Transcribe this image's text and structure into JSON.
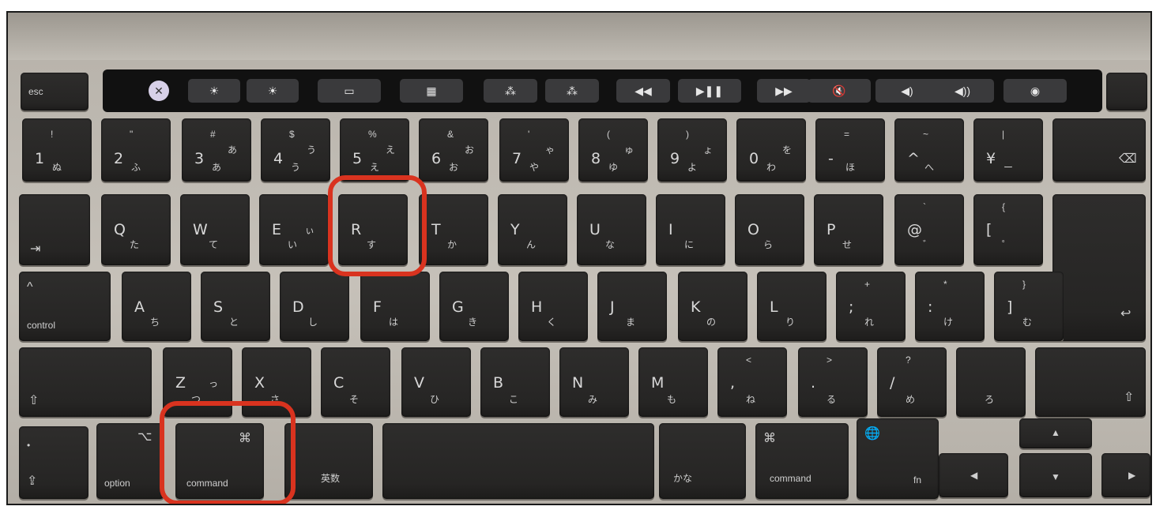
{
  "touch_bar": {
    "esc": "esc",
    "icons": [
      "close-icon",
      "brightness-down-icon",
      "brightness-up-icon",
      "mission-control-icon",
      "launchpad-icon",
      "keyboard-backlight-down-icon",
      "keyboard-backlight-up-icon",
      "rewind-icon",
      "play-pause-icon",
      "fast-forward-icon",
      "mute-icon",
      "volume-down-icon",
      "volume-up-icon",
      "siri-icon"
    ]
  },
  "row_numbers": [
    {
      "main": "1",
      "shift": "!",
      "kana": "ぬ"
    },
    {
      "main": "2",
      "shift": "\"",
      "kana": "ふ"
    },
    {
      "main": "3",
      "shift": "#",
      "kana": "あ",
      "kana2": "あ"
    },
    {
      "main": "4",
      "shift": "$",
      "kana": "う",
      "kana2": "う"
    },
    {
      "main": "5",
      "shift": "%",
      "kana": "え",
      "kana2": "え"
    },
    {
      "main": "6",
      "shift": "&",
      "kana": "お",
      "kana2": "お"
    },
    {
      "main": "7",
      "shift": "'",
      "kana": "や",
      "kana2": "ゃ"
    },
    {
      "main": "8",
      "shift": "(",
      "kana": "ゆ",
      "kana2": "ゅ"
    },
    {
      "main": "9",
      "shift": ")",
      "kana": "よ",
      "kana2": "ょ"
    },
    {
      "main": "0",
      "shift": "",
      "kana": "わ",
      "kana2": "を"
    },
    {
      "main": "-",
      "shift": "=",
      "kana": "ほ"
    },
    {
      "main": "^",
      "shift": "~",
      "kana": "へ"
    },
    {
      "main": "¥",
      "shift": "|",
      "kana": "ー"
    }
  ],
  "delete_glyph": "⌫",
  "tab_glyph": "⇥",
  "row_qwerty": [
    {
      "main": "Q",
      "kana": "た"
    },
    {
      "main": "W",
      "kana": "て"
    },
    {
      "main": "E",
      "kana": "い",
      "kana2": "ぃ"
    },
    {
      "main": "R",
      "kana": "す"
    },
    {
      "main": "T",
      "kana": "か"
    },
    {
      "main": "Y",
      "kana": "ん"
    },
    {
      "main": "U",
      "kana": "な"
    },
    {
      "main": "I",
      "kana": "に"
    },
    {
      "main": "O",
      "kana": "ら"
    },
    {
      "main": "P",
      "kana": "せ"
    },
    {
      "main": "@",
      "shift": "`",
      "kana": "゛"
    },
    {
      "main": "[",
      "shift": "{",
      "kana": "゜"
    }
  ],
  "control": {
    "glyph": "^",
    "label": "control"
  },
  "row_asdf": [
    {
      "main": "A",
      "kana": "ち"
    },
    {
      "main": "S",
      "kana": "と"
    },
    {
      "main": "D",
      "kana": "し"
    },
    {
      "main": "F",
      "kana": "は"
    },
    {
      "main": "G",
      "kana": "き"
    },
    {
      "main": "H",
      "kana": "く"
    },
    {
      "main": "J",
      "kana": "ま"
    },
    {
      "main": "K",
      "kana": "の"
    },
    {
      "main": "L",
      "kana": "り"
    },
    {
      "main": ";",
      "shift": "+",
      "kana": "れ"
    },
    {
      "main": ":",
      "shift": "*",
      "kana": "け"
    },
    {
      "main": "]",
      "shift": "}",
      "kana": "む"
    }
  ],
  "return_glyph": "↩",
  "shift_glyph": "⇧",
  "row_zxcv": [
    {
      "main": "Z",
      "kana": "つ",
      "kana2": "っ"
    },
    {
      "main": "X",
      "kana": "さ"
    },
    {
      "main": "C",
      "kana": "そ"
    },
    {
      "main": "V",
      "kana": "ひ"
    },
    {
      "main": "B",
      "kana": "こ"
    },
    {
      "main": "N",
      "kana": "み"
    },
    {
      "main": "M",
      "kana": "も"
    },
    {
      "main": ",",
      "shift": "<",
      "kana": "ね"
    },
    {
      "main": ".",
      "shift": ">",
      "kana": "る"
    },
    {
      "main": "/",
      "shift": "?",
      "kana": "め"
    },
    {
      "main": "",
      "shift": "",
      "kana": "ろ"
    }
  ],
  "bottom": {
    "caps_glyph": "⇪",
    "option_glyph": "⌥",
    "option_label": "option",
    "command_glyph": "⌘",
    "command_label": "command",
    "eisu_label": "英数",
    "kana_label": "かな",
    "fn_label": "fn",
    "globe_glyph": "🌐",
    "arrow_up": "▲",
    "arrow_down": "▼",
    "arrow_left": "◀",
    "arrow_right": "▶"
  },
  "highlight_color": "#d9331f"
}
